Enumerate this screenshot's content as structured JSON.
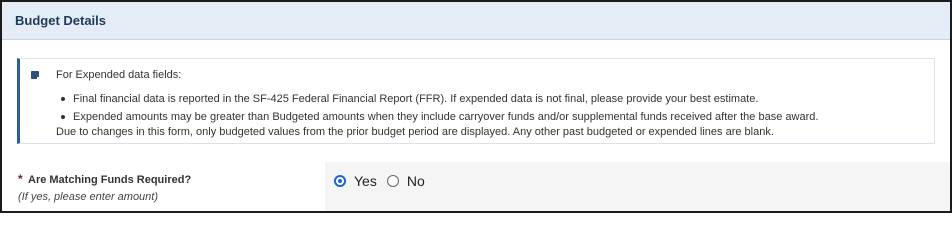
{
  "section": {
    "title": "Budget Details"
  },
  "info": {
    "heading": "For Expended data fields:",
    "bullets": [
      "Final financial data is reported in the SF-425 Federal Financial Report (FFR). If expended data is not final, please provide your best estimate.",
      "Expended amounts may be greater than Budgeted amounts when they include carryover funds and/or supplemental funds received after the base award."
    ],
    "footer": "Due to changes in this form, only budgeted values from the prior budget period are displayed. Any other past budgeted or expended lines are blank.",
    "icon": "note-icon"
  },
  "question": {
    "required_marker": "*",
    "label": "Are Matching Funds Required?",
    "hint": "(If yes, please enter amount)",
    "options": [
      "Yes",
      "No"
    ],
    "selected": "Yes"
  },
  "colors": {
    "header_bg": "#e4edf6",
    "accent": "#2d5f8f",
    "radio_selected": "#1a66d1",
    "required": "#7a1c1c"
  }
}
